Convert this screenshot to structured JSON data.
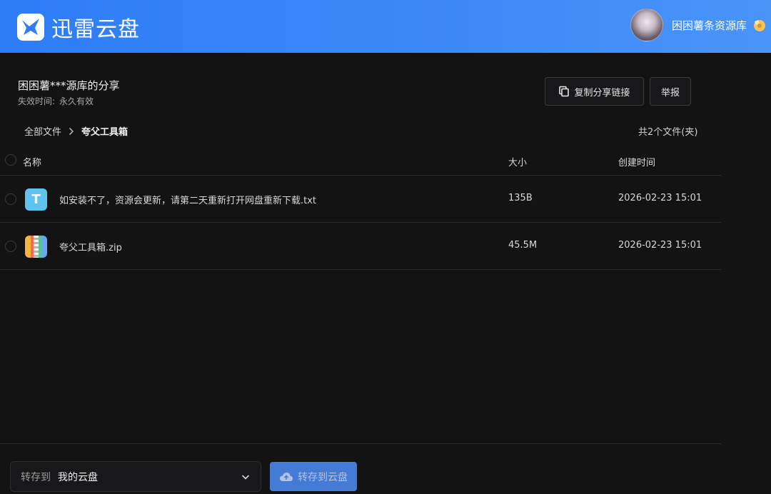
{
  "header": {
    "app_name": "迅雷云盘",
    "user_name": "困困薯条资源库",
    "logo_icon": "thunder-bird-icon",
    "vip_icon": "vip-badge-icon"
  },
  "share": {
    "title": "困困薯***源库的分享",
    "expire_label": "失效时间:",
    "expire_value": "永久有效",
    "copy_link_label": "复制分享链接",
    "report_label": "举报"
  },
  "breadcrumb": {
    "root": "全部文件",
    "current": "夸父工具箱"
  },
  "summary": "共2个文件(夹)",
  "table": {
    "headers": {
      "name": "名称",
      "size": "大小",
      "created": "创建时间"
    },
    "rows": [
      {
        "icon": "text-file-icon",
        "icon_letter": "T",
        "name": "如安装不了，资源会更新，请第二天重新打开网盘重新下载.txt",
        "size": "135B",
        "created": "2026-02-23 15:01"
      },
      {
        "icon": "zip-file-icon",
        "name": "夸父工具箱.zip",
        "size": "45.5M",
        "created": "2026-02-23 15:01"
      }
    ]
  },
  "footer": {
    "save_to_label": "转存到",
    "save_to_value": "我的云盘",
    "save_button": "转存到云盘"
  },
  "colors": {
    "header_blue": "#2e7cf6",
    "background": "#131314",
    "primary_button": "#4d8ef8"
  }
}
